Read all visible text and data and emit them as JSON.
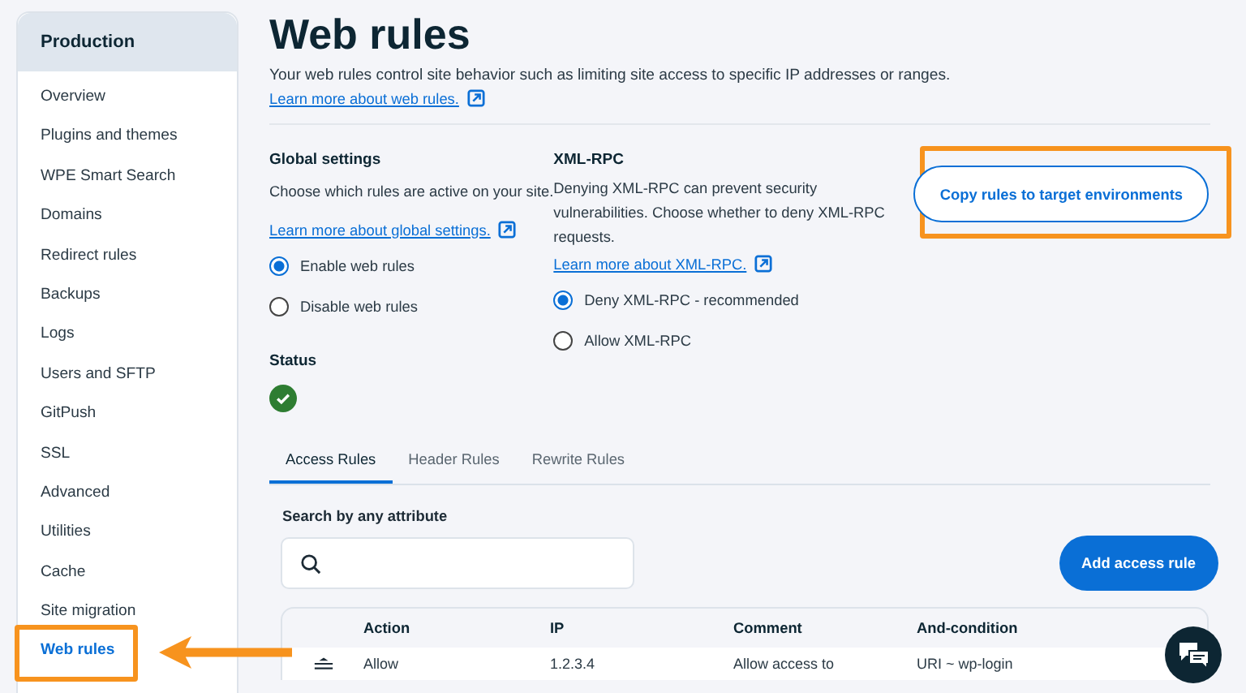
{
  "sidebar": {
    "title": "Production",
    "items": [
      {
        "label": "Overview",
        "selected": false
      },
      {
        "label": "Plugins and themes",
        "selected": false
      },
      {
        "label": "WPE Smart Search",
        "selected": false
      },
      {
        "label": "Domains",
        "selected": false
      },
      {
        "label": "Redirect rules",
        "selected": false
      },
      {
        "label": "Backups",
        "selected": false
      },
      {
        "label": "Logs",
        "selected": false
      },
      {
        "label": "Users and SFTP",
        "selected": false
      },
      {
        "label": "GitPush",
        "selected": false
      },
      {
        "label": "SSL",
        "selected": false
      },
      {
        "label": "Advanced",
        "selected": false
      },
      {
        "label": "Utilities",
        "selected": false
      },
      {
        "label": "Cache",
        "selected": false
      },
      {
        "label": "Site migration",
        "selected": false
      },
      {
        "label": "Web rules",
        "selected": true
      }
    ]
  },
  "page": {
    "title": "Web rules",
    "description": "Your web rules control site behavior such as limiting site access to specific IP addresses or ranges.",
    "link": "Learn more about web rules."
  },
  "global_settings": {
    "heading": "Global settings",
    "description": "Choose which rules are active on your site.",
    "link": "Learn more about global settings.",
    "options": [
      {
        "label": "Enable web rules",
        "selected": true
      },
      {
        "label": "Disable web rules",
        "selected": false
      }
    ]
  },
  "xml_rpc": {
    "heading": "XML-RPC",
    "description": "Denying XML-RPC can prevent security vulnerabilities. Choose whether to deny XML-RPC requests.",
    "link": "Learn more about XML-RPC.",
    "options": [
      {
        "label": "Deny XML-RPC - recommended",
        "selected": true
      },
      {
        "label": "Allow XML-RPC",
        "selected": false
      }
    ]
  },
  "copy_button": "Copy rules to target environments",
  "status": {
    "heading": "Status"
  },
  "tabs": [
    {
      "label": "Access Rules",
      "selected": true
    },
    {
      "label": "Header Rules",
      "selected": false
    },
    {
      "label": "Rewrite Rules",
      "selected": false
    }
  ],
  "search": {
    "label": "Search by any attribute"
  },
  "add_button": "Add access rule",
  "table": {
    "columns": [
      "Action",
      "IP",
      "Comment",
      "And-condition"
    ],
    "rows": [
      {
        "cells": [
          "Allow",
          "1.2.3.4",
          "Allow access to",
          "URI ~ wp-login"
        ]
      }
    ]
  }
}
